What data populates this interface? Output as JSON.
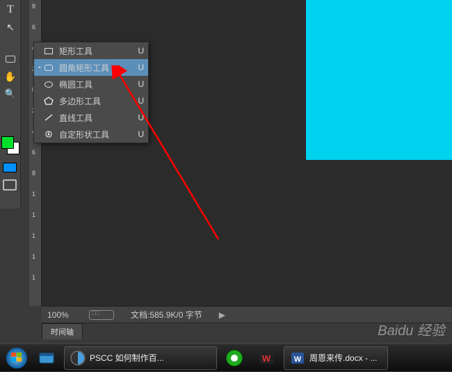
{
  "tools_left": [
    {
      "name": "type-tool-icon",
      "glyph": "T"
    },
    {
      "name": "path-select-icon",
      "glyph": "↖"
    },
    {
      "name": "rectangle-tool-icon",
      "glyph": "▭"
    },
    {
      "name": "hand-tool-icon",
      "glyph": "✋"
    },
    {
      "name": "zoom-tool-icon",
      "glyph": "🔍"
    }
  ],
  "ruler_ticks": [
    "8",
    "6",
    "4",
    "2",
    "0",
    "2",
    "4",
    "6",
    "8",
    "1",
    "1",
    "1",
    "1",
    "1"
  ],
  "shape_popup": {
    "items": [
      {
        "label": "矩形工具",
        "key": "U",
        "selected": false,
        "icon": "rect-icon"
      },
      {
        "label": "圆角矩形工具",
        "key": "U",
        "selected": true,
        "icon": "roundrect-icon"
      },
      {
        "label": "椭圆工具",
        "key": "U",
        "selected": false,
        "icon": "ellipse-icon"
      },
      {
        "label": "多边形工具",
        "key": "U",
        "selected": false,
        "icon": "polygon-icon"
      },
      {
        "label": "直线工具",
        "key": "U",
        "selected": false,
        "icon": "line-icon"
      },
      {
        "label": "自定形状工具",
        "key": "U",
        "selected": false,
        "icon": "custom-shape-icon"
      }
    ]
  },
  "status": {
    "zoom": "100%",
    "doc_info": "文档:585.9K/0 字节",
    "play": "▶"
  },
  "timeline": {
    "tab_label": "时间轴"
  },
  "taskbar": {
    "active_app": "PSCC 如何制作百...",
    "doc_item": "周恩来传.docx - ..."
  },
  "watermark": "Baidu 经验"
}
